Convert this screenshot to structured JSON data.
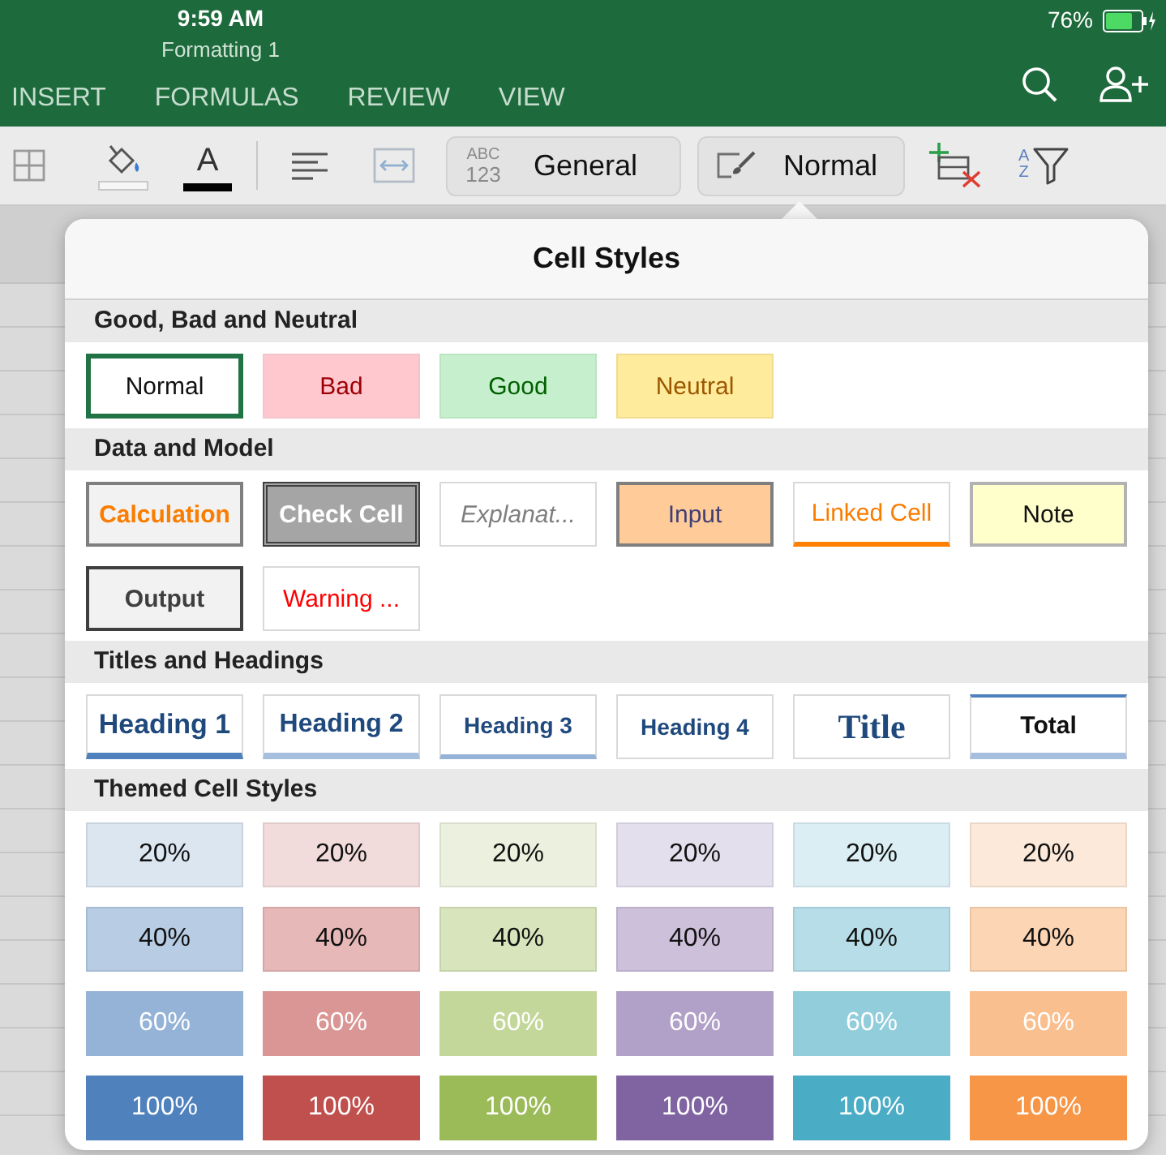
{
  "status_bar": {
    "time": "9:59 AM",
    "document_title": "Formatting 1",
    "battery": "76%"
  },
  "ribbon_tabs": [
    {
      "label": "INSERT",
      "selected": false
    },
    {
      "label": "FORMULAS",
      "selected": false
    },
    {
      "label": "REVIEW",
      "selected": false
    },
    {
      "label": "VIEW",
      "selected": false
    }
  ],
  "toolbar": {
    "font_color_glyph": "A",
    "number_format": {
      "icon_text": [
        "ABC",
        "123"
      ],
      "value": "General"
    },
    "cell_style": {
      "value": "Normal"
    },
    "sort_letters": [
      "A",
      "Z"
    ]
  },
  "cell_styles_popover": {
    "title": "Cell Styles",
    "sections": [
      {
        "title": "Good, Bad and Neutral",
        "styles": [
          {
            "label": "Normal",
            "kind": "normal",
            "selected": true
          },
          {
            "label": "Bad",
            "kind": "bad",
            "selected": false
          },
          {
            "label": "Good",
            "kind": "good",
            "selected": false
          },
          {
            "label": "Neutral",
            "kind": "neutral",
            "selected": false
          }
        ]
      },
      {
        "title": "Data and Model",
        "styles": [
          {
            "label": "Calculation",
            "kind": "calculation",
            "selected": false
          },
          {
            "label": "Check Cell",
            "kind": "check",
            "selected": false
          },
          {
            "label": "Explanat...",
            "kind": "explanatory",
            "selected": false
          },
          {
            "label": "Input",
            "kind": "input",
            "selected": false
          },
          {
            "label": "Linked Cell",
            "kind": "linked",
            "selected": false
          },
          {
            "label": "Note",
            "kind": "note",
            "selected": false
          },
          {
            "label": "Output",
            "kind": "output",
            "selected": false
          },
          {
            "label": "Warning ...",
            "kind": "warning",
            "selected": false
          }
        ]
      },
      {
        "title": "Titles and Headings",
        "styles": [
          {
            "label": "Heading 1",
            "kind": "heading1",
            "selected": false
          },
          {
            "label": "Heading 2",
            "kind": "heading2",
            "selected": false
          },
          {
            "label": "Heading 3",
            "kind": "heading3",
            "selected": false
          },
          {
            "label": "Heading 4",
            "kind": "heading4",
            "selected": false
          },
          {
            "label": "Title",
            "kind": "title",
            "selected": false
          },
          {
            "label": "Total",
            "kind": "total",
            "selected": false
          }
        ]
      },
      {
        "title": "Themed Cell Styles",
        "styles": [
          {
            "label": "20%",
            "kind": "accent1_20",
            "selected": false
          },
          {
            "label": "20%",
            "kind": "accent2_20",
            "selected": false
          },
          {
            "label": "20%",
            "kind": "accent3_20",
            "selected": false
          },
          {
            "label": "20%",
            "kind": "accent4_20",
            "selected": false
          },
          {
            "label": "20%",
            "kind": "accent5_20",
            "selected": false
          },
          {
            "label": "20%",
            "kind": "accent6_20",
            "selected": false
          },
          {
            "label": "40%",
            "kind": "accent1_40",
            "selected": false
          },
          {
            "label": "40%",
            "kind": "accent2_40",
            "selected": false
          },
          {
            "label": "40%",
            "kind": "accent3_40",
            "selected": false
          },
          {
            "label": "40%",
            "kind": "accent4_40",
            "selected": false
          },
          {
            "label": "40%",
            "kind": "accent5_40",
            "selected": false
          },
          {
            "label": "40%",
            "kind": "accent6_40",
            "selected": false
          },
          {
            "label": "60%",
            "kind": "accent1_60",
            "selected": false
          },
          {
            "label": "60%",
            "kind": "accent2_60",
            "selected": false
          },
          {
            "label": "60%",
            "kind": "accent3_60",
            "selected": false
          },
          {
            "label": "60%",
            "kind": "accent4_60",
            "selected": false
          },
          {
            "label": "60%",
            "kind": "accent5_60",
            "selected": false
          },
          {
            "label": "60%",
            "kind": "accent6_60",
            "selected": false
          },
          {
            "label": "100%",
            "kind": "accent1_100",
            "selected": false
          },
          {
            "label": "100%",
            "kind": "accent2_100",
            "selected": false
          },
          {
            "label": "100%",
            "kind": "accent3_100",
            "selected": false
          },
          {
            "label": "100%",
            "kind": "accent4_100",
            "selected": false
          },
          {
            "label": "100%",
            "kind": "accent5_100",
            "selected": false
          },
          {
            "label": "100%",
            "kind": "accent6_100",
            "selected": false
          }
        ]
      }
    ]
  }
}
